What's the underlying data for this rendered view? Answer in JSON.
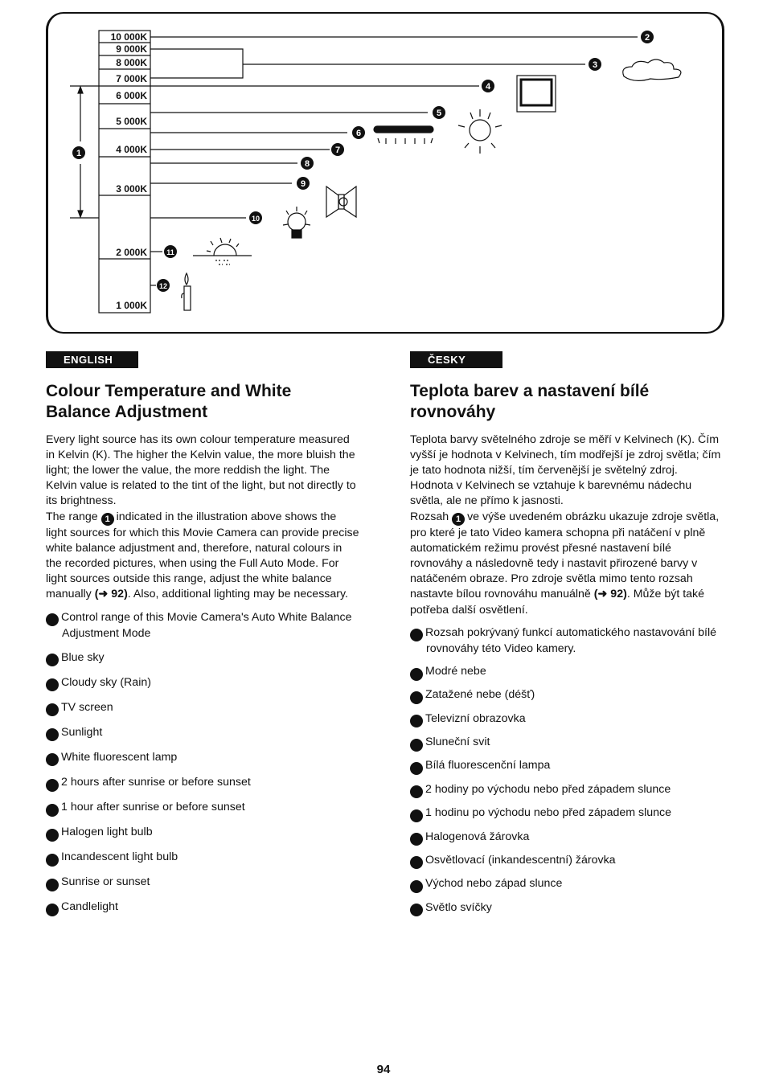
{
  "diagram": {
    "scale": [
      "10 000K",
      "9 000K",
      "8 000K",
      "7 000K",
      "6 000K",
      "5 000K",
      "4 000K",
      "3 000K",
      "2 000K",
      "1 000K"
    ],
    "markers": [
      "1",
      "2",
      "3",
      "4",
      "5",
      "6",
      "7",
      "8",
      "9",
      "10",
      "11",
      "12"
    ]
  },
  "english": {
    "badge": "ENGLISH",
    "title": "Colour Temperature and White Balance Adjustment",
    "para1": "Every light source has its own colour temperature measured in Kelvin (K). The higher the Kelvin value, the more bluish the light; the lower the value, the more reddish the light. The Kelvin value is related to the tint of the light, but not directly to its brightness.",
    "para2_pre": "The range",
    "para2_post": "indicated in the illustration above shows the light sources for which this Movie Camera can provide precise white balance adjustment and, therefore, natural colours in the recorded pictures, when using the Full Auto Mode. For light sources outside this range, adjust the white balance manually",
    "ref": "(➜ 92)",
    "para2_end": ". Also, additional lighting may be necessary.",
    "items": [
      "Control range of this Movie Camera's Auto White Balance Adjustment Mode",
      "Blue sky",
      "Cloudy sky (Rain)",
      "TV screen",
      "Sunlight",
      "White fluorescent lamp",
      "2 hours after sunrise or before sunset",
      "1 hour after sunrise or before sunset",
      "Halogen light bulb",
      "Incandescent light bulb",
      "Sunrise or sunset",
      "Candlelight"
    ]
  },
  "czech": {
    "badge": "ČESKY",
    "title": "Teplota barev a nastavení bílé rovnováhy",
    "para1": "Teplota barvy světelného zdroje se měří v Kelvinech (K). Čím vyšší je hodnota v Kelvinech, tím modřejší je zdroj světla; čím je tato hodnota nižší, tím červenější je světelný zdroj. Hodnota v Kelvinech se vztahuje k barevnému nádechu světla, ale ne přímo k jasnosti.",
    "para2_pre": "Rozsah",
    "para2_post": "ve výše uvedeném obrázku ukazuje zdroje světla, pro které je tato Video kamera schopna při natáčení v plně automatickém režimu provést přesné nastavení bílé rovnováhy a následovně tedy i nastavit přirozené barvy v natáčeném obraze. Pro zdroje světla mimo tento rozsah nastavte bílou rovnováhu manuálně",
    "ref": "(➜ 92)",
    "para2_end": ". Může být také potřeba další osvětlení.",
    "items": [
      "Rozsah pokrývaný funkcí automatického nastavování bílé rovnováhy této Video kamery.",
      "Modré nebe",
      "Zatažené nebe (déšť)",
      "Televizní obrazovka",
      "Sluneční svit",
      "Bílá fluorescenční lampa",
      "2 hodiny po východu nebo před západem slunce",
      "1 hodinu po východu nebo před západem slunce",
      "Halogenová žárovka",
      "Osvětlovací (inkandescentní) žárovka",
      "Východ nebo západ slunce",
      "Světlo svíčky"
    ]
  },
  "page_number": "94"
}
